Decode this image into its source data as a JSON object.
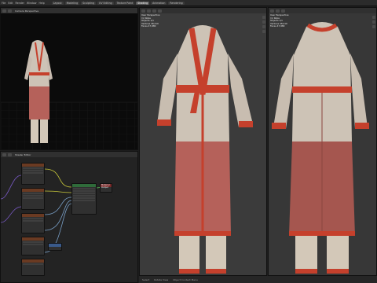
{
  "topbar": {
    "menu": [
      "File",
      "Edit",
      "Render",
      "Window",
      "Help"
    ],
    "workspaces": [
      "Layout",
      "Modeling",
      "Sculpting",
      "UV Editing",
      "Texture Paint",
      "Shading",
      "Animation",
      "Rendering"
    ]
  },
  "left_viewport": {
    "label": "Camera Perspective"
  },
  "node_editor": {
    "label": "Shader Editor",
    "output_node": "Material Output"
  },
  "mid_viewport": {
    "overlay": [
      "User Perspective",
      "(1) Robe",
      "Objects 1/1",
      "Vertices 48,210",
      "Faces 47,980"
    ]
  },
  "right_viewport": {
    "overlay": [
      "User Perspective",
      "(1) Robe",
      "Objects 1/1",
      "Vertices 48,210",
      "Faces 47,980"
    ]
  },
  "statusbar": {
    "items": [
      "Select",
      "Rotate View",
      "Object Context Menu"
    ]
  },
  "colors": {
    "robe_light": "#cdc3b6",
    "robe_red": "#b5615a",
    "trim": "#c5402c",
    "pants": "#d3c8b8"
  }
}
